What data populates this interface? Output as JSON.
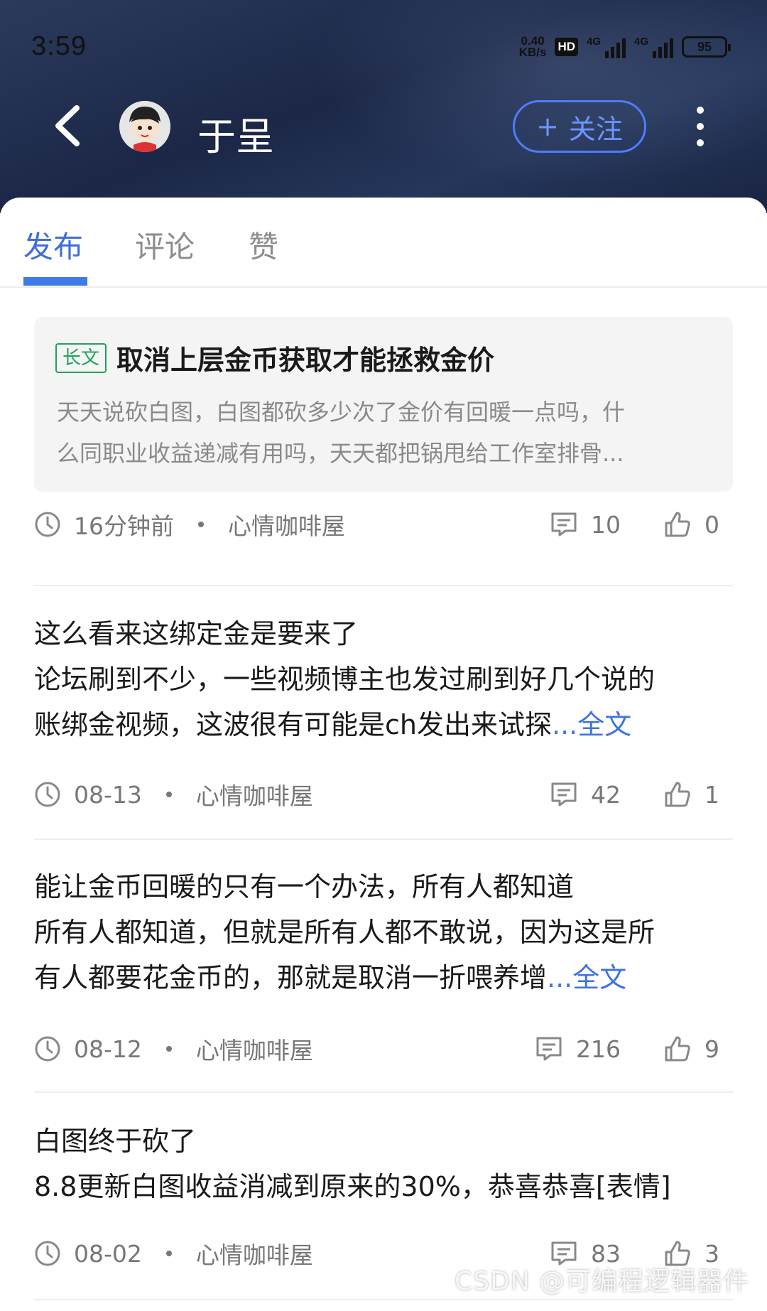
{
  "status_bar": {
    "time": "3:59",
    "net_speed_value": "0.40",
    "net_speed_unit": "KB/s",
    "hd_label": "HD",
    "signal1_label": "4G",
    "signal2_label": "4G",
    "battery": "95"
  },
  "header": {
    "user_name": "于呈",
    "follow_plus": "+",
    "follow_label": "关注"
  },
  "tabs": [
    {
      "label": "发布",
      "active": true
    },
    {
      "label": "评论",
      "active": false
    },
    {
      "label": "赞",
      "active": false
    }
  ],
  "posts": [
    {
      "badge": "长文",
      "title": "取消上层金币获取才能拯救金价",
      "excerpt_line1": "天天说砍白图，白图都砍多少次了金价有回暖一点吗，什",
      "excerpt_line2": "么同职业收益递减有用吗，天天都把锅甩给工作室排骨...",
      "time": "16分钟前",
      "forum": "心情咖啡屋",
      "comments": "10",
      "likes": "0"
    },
    {
      "title": "这么看来这绑定金是要来了",
      "body_line1": "论坛刷到不少，一些视频博主也发过刷到好几个说的",
      "body_line2": "账绑金视频，这波很有可能是ch发出来试探",
      "more": "...全文",
      "time": "08-13",
      "forum": "心情咖啡屋",
      "comments": "42",
      "likes": "1"
    },
    {
      "title": "能让金币回暖的只有一个办法，所有人都知道",
      "body_line1": "所有人都知道，但就是所有人都不敢说，因为这是所",
      "body_line2": "有人都要花金币的，那就是取消一折喂养增",
      "more": "...全文",
      "time": "08-12",
      "forum": "心情咖啡屋",
      "comments": "216",
      "likes": "9"
    },
    {
      "title": "白图终于砍了",
      "body_line1": "8.8更新白图收益消减到原来的30%，恭喜恭喜[表情]",
      "time": "08-02",
      "forum": "心情咖啡屋",
      "comments": "83",
      "likes": "3"
    }
  ],
  "watermark": "CSDN @可编程逻辑器件",
  "colors": {
    "accent": "#3d7ae5",
    "link": "#3d74e0",
    "badge_green": "#22a05f",
    "header_dark": "#1c2747"
  },
  "icons": [
    "back-arrow-icon",
    "clock-icon",
    "comment-icon",
    "thumbs-up-icon",
    "more-vertical-icon"
  ]
}
